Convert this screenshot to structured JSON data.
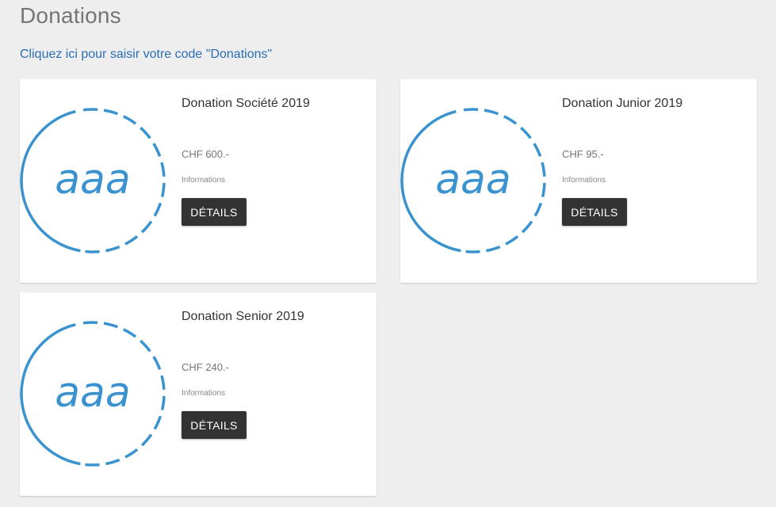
{
  "page": {
    "title": "Donations",
    "code_link": "Cliquez ici pour saisir votre code \"Donations\""
  },
  "logo": {
    "text": "aaa",
    "color": "#3a93cf",
    "ring_dark": "#2f6e9c"
  },
  "cards": [
    {
      "name": "Donation Société 2019",
      "price": "CHF 600.-",
      "info": "Informations",
      "button": "DÉTAILS"
    },
    {
      "name": "Donation Junior 2019",
      "price": "CHF 95.-",
      "info": "Informations",
      "button": "DÉTAILS"
    },
    {
      "name": "Donation Senior 2019",
      "price": "CHF 240.-",
      "info": "Informations",
      "button": "DÉTAILS"
    }
  ]
}
